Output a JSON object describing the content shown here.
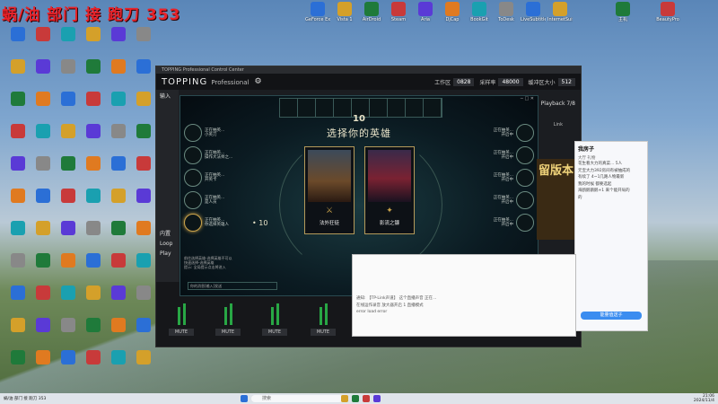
{
  "stream_title": "蜗/油 部门 接 跑刀 353",
  "desktop_icons_top": [
    "GeForce Experience",
    "Vista 1",
    "AirDroid",
    "Steam",
    "Aria",
    "DjCap",
    "BookGit",
    "ToDesk",
    "LiveSubtitle",
    "InternetSuite",
    "主机",
    "BeautyPro"
  ],
  "topping": {
    "titlebar": "TOPPING Professional Control Center",
    "brand": "TOPPING",
    "brand_sub": "Professional",
    "workspace_label": "工作区",
    "workspace_value": "0828",
    "samplerate_label": "采样率",
    "samplerate_value": "48000",
    "buffer_label": "缓冲区大小",
    "buffer_value": "512",
    "side_input": "输入",
    "side_inside": "内置",
    "side_loop": "Loop",
    "side_play": "Play",
    "playback_label": "Playback 7/8",
    "link_label": "Link",
    "mute_label": "MUTE"
  },
  "game": {
    "timer": "10",
    "title": "选择你的英雄",
    "level": "• 10",
    "left_players": [
      {
        "name": "正在抽英...",
        "sub": "小英刀"
      },
      {
        "name": "正在抽英...",
        "sub": "操作大法师之..."
      },
      {
        "name": "正在抽英...",
        "sub": "开英卡"
      },
      {
        "name": "正在抽英...",
        "sub": "是人员"
      },
      {
        "name": "正在抽英...",
        "sub": "你选择英雄人"
      }
    ],
    "right_players": [
      {
        "name": "正在抽英...",
        "sub": "开启中"
      },
      {
        "name": "正在抽英...",
        "sub": "开启中"
      },
      {
        "name": "正在抽英...",
        "sub": "开启中"
      },
      {
        "name": "正在抽英...",
        "sub": "开启中"
      },
      {
        "name": "正在抽英...",
        "sub": "开启中"
      }
    ],
    "card1": "法外狂徒",
    "card2": "影流之镰",
    "quit": "退出",
    "chat_lines": [
      "前往选择英雄-选择英雄不可以",
      "快速选择-选择英雄",
      "提示: 全局提示点击将进入"
    ],
    "chat_placeholder": "你的消息[输入]发送"
  },
  "chat": {
    "title": "我房子",
    "tabs": "大厅  礼物",
    "messages": [
      "花生看大力的真菜... 5人",
      "元宝大力392房间有被抽成的",
      "有续了 4~1几路人物最新 ",
      "我的时候 都要选起",
      "海鸥鹅鹅鹅+1 来个能开局的",
      "的"
    ],
    "gift_button": "能量值送子",
    "ad_text": "留版本"
  },
  "streamwin": {
    "rows": [
      "通知: 【TP-Link声道】 这个直播声音 正在...",
      "在线运作录音 放大器开启 1 直播模式",
      "error load error"
    ]
  },
  "taskbar": {
    "search": "搜索",
    "clock_time": "21:06",
    "clock_date": "2024/11/4",
    "left_app": "蜗/油 部门 接 跑刀 353"
  }
}
